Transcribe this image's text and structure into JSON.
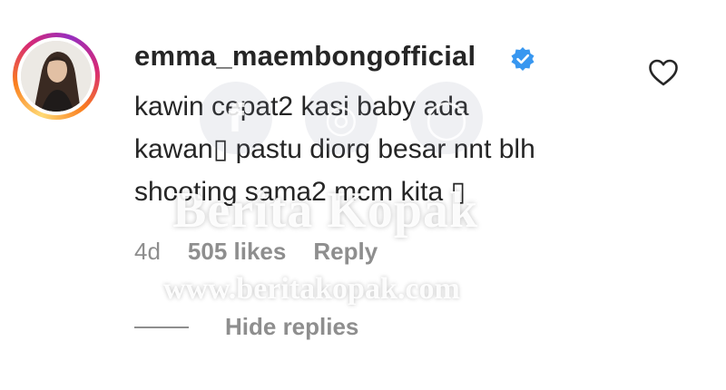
{
  "comment": {
    "username": "emma_maembongofficial",
    "verified": true,
    "text": "kawin cepat2 kasi baby ada\nkawan▯ pastu diorg besar nnt blh\nshooting sama2 mcm kita ▯",
    "time": "4d",
    "likes": "505 likes",
    "reply_label": "Reply",
    "hide_replies_label": "Hide replies"
  },
  "icons": {
    "verified": "verified-badge-icon",
    "like": "heart-outline-icon"
  },
  "watermark": {
    "title": "Berita Kopak",
    "url": "www.beritakopak.com",
    "icons": [
      "f",
      "◎",
      "◯"
    ]
  },
  "colors": {
    "text": "#262626",
    "muted": "#8e8e8e",
    "verified": "#3897f0"
  }
}
